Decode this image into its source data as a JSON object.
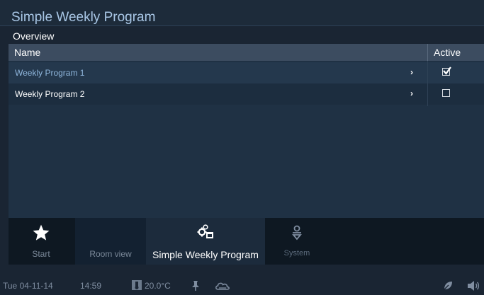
{
  "app": {
    "title": "Simple Weekly Program"
  },
  "overview": {
    "section_label": "Overview",
    "columns": {
      "name": "Name",
      "active": "Active"
    },
    "rows": [
      {
        "name": "Weekly Program 1",
        "active": true
      },
      {
        "name": "Weekly Program 2",
        "active": false
      }
    ]
  },
  "nav": {
    "tabs": [
      {
        "label": "Start",
        "icon": "star-icon"
      },
      {
        "label": "Room view"
      },
      {
        "label": "Simple Weekly Program",
        "icon": "gear-calendar-icon",
        "selected": true
      },
      {
        "label": "System",
        "icon": "system-icon"
      }
    ]
  },
  "status": {
    "date": "Tue 04-11-14",
    "time": "14:59",
    "temperature": "20.0°C",
    "icons": [
      "thermometer-icon",
      "pin-icon",
      "cloud-icon",
      "settings-leaf-icon",
      "speaker-icon"
    ]
  },
  "colors": {
    "background": "#1a2533",
    "title": "#a9c7e6",
    "header": "#3c4c60",
    "selected_row_text": "#8fb6dc"
  }
}
